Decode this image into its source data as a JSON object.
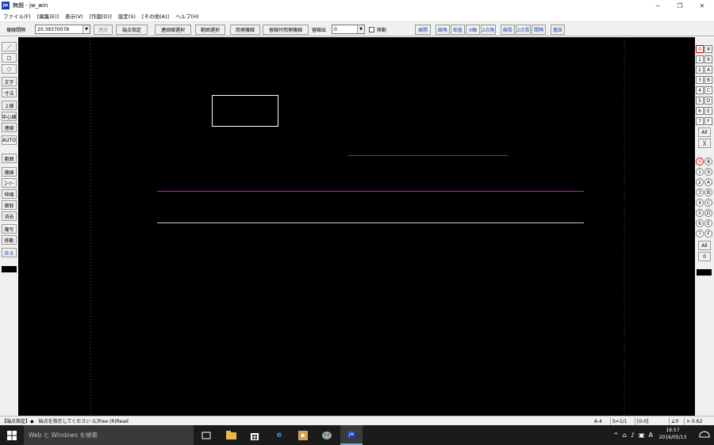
{
  "window": {
    "title": "無題 - jw_win",
    "app_icon_label": "jw",
    "minimize": "─",
    "restore": "❐",
    "close": "✕"
  },
  "menu": [
    "ファイル(F)",
    "[編集(E)]",
    "表示(V)",
    "[作図(D)]",
    "設定(S)",
    "[その他(A)]",
    "ヘルプ(H)"
  ],
  "toolbar": {
    "interval_label": "複線間隔",
    "interval_value": "20.39370078",
    "renzoku": "連続",
    "tanten_shitei": "端点指定",
    "renzoku_sen_sentaku": "連続線選択",
    "hani_sentaku": "範囲選択",
    "ryougawa_fukusen": "両側複線",
    "tomesen_tsuki": "留線付両側複線",
    "tomesen_de_label": "留線出",
    "tomesen_de_value": "0",
    "idou_label": "移動",
    "tenkai": "展開",
    "senkaku": "線角",
    "enchoku": "鉛直",
    "x_jiku": "X軸",
    "niten_kaku": "2点角",
    "sencho": "線長",
    "niten_cho": "2点長",
    "kankaku": "間隔",
    "kijun": "基設"
  },
  "left_tools": [
    "／",
    "□",
    "○",
    "文字",
    "寸法",
    "２線",
    "中心線",
    "連線",
    "AUTO",
    "範囲",
    "複線",
    "ｺｰﾅｰ",
    "伸縮",
    "面取",
    "消去",
    "複写",
    "移動",
    "戻る"
  ],
  "layer_groups": [
    "0",
    "8",
    "1",
    "9",
    "2",
    "A",
    "3",
    "B",
    "4",
    "C",
    "5",
    "D",
    "6",
    "E",
    "7",
    "F"
  ],
  "layers_circled": [
    "0",
    "8",
    "1",
    "9",
    "2",
    "A",
    "3",
    "B",
    "4",
    "C",
    "5",
    "D",
    "6",
    "E",
    "7",
    "F"
  ],
  "right_buttons": {
    "all_top": "All",
    "x_btn": "╳",
    "all_bottom": "All",
    "zero": "0"
  },
  "status": {
    "message": "【端点指定】◆　始点を指示してください (L)free (R)Read",
    "paper": "A-4",
    "scale": "S=1/1",
    "layer": "[0-0]",
    "angle": "∠0",
    "zoom": "× 0.62"
  },
  "taskbar": {
    "search_placeholder": "Web と Windows を検索",
    "time": "19:57",
    "date": "2016/05/13",
    "ime": "A"
  },
  "colors": {
    "canvas": "#000000",
    "rect_line": "#ffffff",
    "red_line": "#c8102e",
    "magenta_line": "#c020c0",
    "gray_line": "#c8c8c8",
    "frame_dotted": "#a020a0"
  }
}
